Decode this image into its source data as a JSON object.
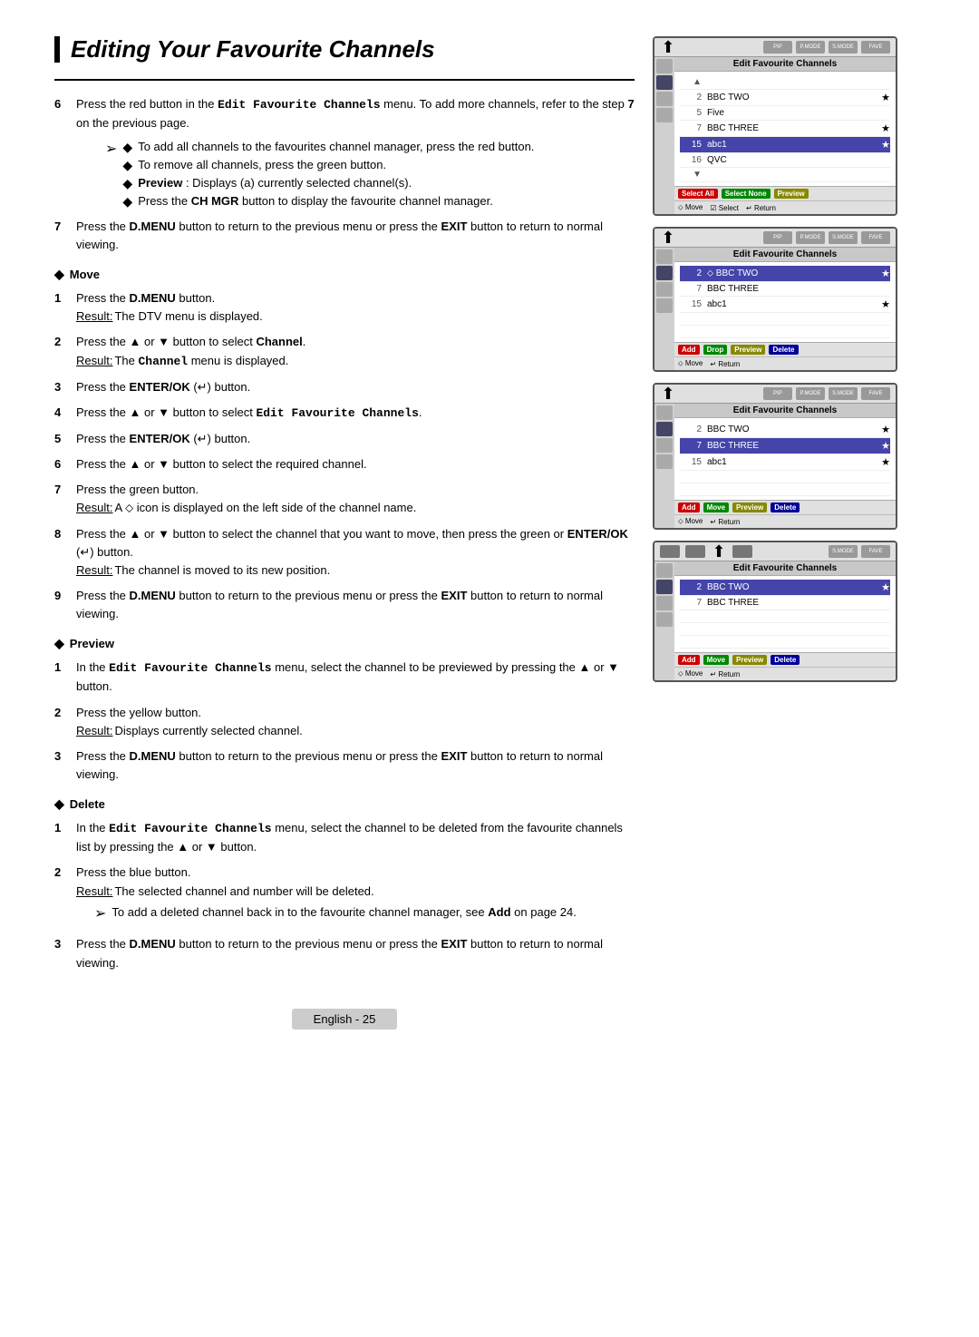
{
  "page": {
    "title": "Editing Your Favourite Channels",
    "footer_label": "English - 25"
  },
  "sections": {
    "intro": {
      "step6_text": "Press the red button in the Edit Favourite Channels menu. To add more channels, refer to the step 7 on the previous page.",
      "bullet1": "To add all channels to the favourites channel manager, press the red button.",
      "bullet2": "To remove all channels, press the green button.",
      "bullet3": "Preview : Displays (a) currently selected channel(s).",
      "bullet4": "Press the CH MGR button to display the favourite channel manager.",
      "step7_text": "Press the D.MENU button to return to the previous menu or press the EXIT button to return to normal viewing."
    },
    "move": {
      "header": "Move",
      "steps": [
        {
          "num": "1",
          "text": "Press the D.MENU button.",
          "result": "The DTV menu is displayed."
        },
        {
          "num": "2",
          "text": "Press the ▲ or ▼ button to select Channel.",
          "result": "The Channel menu is displayed."
        },
        {
          "num": "3",
          "text": "Press the ENTER/OK (↵) button.",
          "result": ""
        },
        {
          "num": "4",
          "text": "Press the ▲ or ▼ button to select Edit Favourite Channels.",
          "result": ""
        },
        {
          "num": "5",
          "text": "Press the ENTER/OK (↵) button.",
          "result": ""
        },
        {
          "num": "6",
          "text": "Press the ▲ or ▼ button to select the required channel.",
          "result": ""
        },
        {
          "num": "7",
          "text": "Press the green button.",
          "result": "A ⬦ icon is displayed on the left side of the channel name."
        },
        {
          "num": "8",
          "text": "Press the ▲ or ▼ button to select the channel that you want to move, then press the green or ENTER/OK (↵) button.",
          "result": "The channel is moved to its new position."
        },
        {
          "num": "9",
          "text": "Press the D.MENU button to return to the previous menu or press the EXIT button to return to normal viewing.",
          "result": ""
        }
      ]
    },
    "preview": {
      "header": "Preview",
      "steps": [
        {
          "num": "1",
          "text": "In the Edit Favourite Channels menu, select the channel to be previewed by pressing the ▲ or ▼ button.",
          "result": ""
        },
        {
          "num": "2",
          "text": "Press the yellow button.",
          "result": "Displays currently selected channel."
        },
        {
          "num": "3",
          "text": "Press the D.MENU button to return to the previous menu or press the EXIT button to return to normal viewing.",
          "result": ""
        }
      ]
    },
    "delete": {
      "header": "Delete",
      "steps": [
        {
          "num": "1",
          "text": "In the Edit Favourite Channels menu, select the channel to be deleted from the favourite channels list by pressing the ▲ or ▼ button.",
          "result": ""
        },
        {
          "num": "2",
          "text": "Press the blue button.",
          "result": "The selected channel and number will be deleted.",
          "arrow_note": "To add a deleted channel back in to the favourite channel manager, see Add on page 24."
        },
        {
          "num": "3",
          "text": "Press the D.MENU button to return to the previous menu or press the EXIT button to return to normal viewing.",
          "result": ""
        }
      ]
    }
  },
  "screens": {
    "screen1": {
      "title": "Edit Favourite Channels",
      "channels": [
        {
          "num": "2",
          "name": "BBC TWO",
          "star": true,
          "highlighted": false
        },
        {
          "num": "5",
          "name": "Five",
          "star": false,
          "highlighted": false
        },
        {
          "num": "7",
          "name": "BBC THREE",
          "star": true,
          "highlighted": false
        },
        {
          "num": "15",
          "name": "abc1",
          "star": true,
          "highlighted": true
        },
        {
          "num": "16",
          "name": "QVC",
          "star": false,
          "highlighted": false
        }
      ],
      "footer_buttons": [
        "Select All",
        "Select None",
        "Preview"
      ],
      "nav": "Move  ☑ Select  ↵ Return"
    },
    "screen2": {
      "title": "Edit Favourite Channels",
      "channels": [
        {
          "num": "2",
          "name": "⬦ BBC TWO",
          "star": true,
          "highlighted": true
        },
        {
          "num": "7",
          "name": "BBC THREE",
          "star": false,
          "highlighted": false
        },
        {
          "num": "15",
          "name": "abc1",
          "star": true,
          "highlighted": false
        }
      ],
      "footer_buttons": [
        "Add",
        "Drop",
        "Preview",
        "Delete"
      ],
      "nav": "Move  ↵ Return"
    },
    "screen3": {
      "title": "Edit Favourite Channels",
      "channels": [
        {
          "num": "2",
          "name": "BBC TWO",
          "star": true,
          "highlighted": false
        },
        {
          "num": "7",
          "name": "BBC THREE",
          "star": true,
          "highlighted": true
        },
        {
          "num": "15",
          "name": "abc1",
          "star": true,
          "highlighted": false
        }
      ],
      "footer_buttons": [
        "Add",
        "Move",
        "Preview",
        "Delete"
      ],
      "nav": "Move  ↵ Return"
    },
    "screen4": {
      "title": "Edit Favourite Channels",
      "channels": [
        {
          "num": "2",
          "name": "BBC TWO",
          "star": true,
          "highlighted": true
        },
        {
          "num": "7",
          "name": "BBC THREE",
          "star": false,
          "highlighted": false
        }
      ],
      "footer_buttons": [
        "Add",
        "Move",
        "Preview",
        "Delete"
      ],
      "nav": "Move  ↵ Return"
    }
  }
}
